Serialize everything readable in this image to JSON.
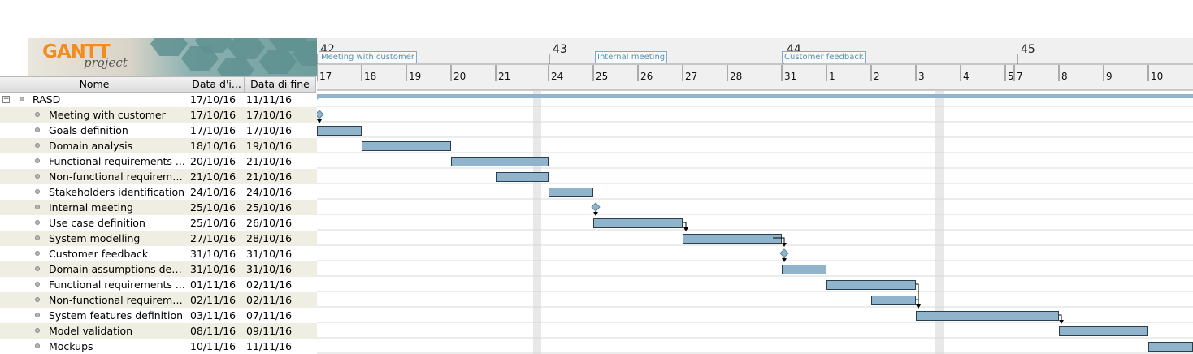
{
  "logo": {
    "brand": "GANTT",
    "product": "project"
  },
  "table": {
    "columns": {
      "name": "Nome",
      "start": "Data d'i...",
      "end": "Data di fine"
    },
    "collapse_symbol": "−",
    "root": {
      "name": "RASD",
      "start": "17/10/16",
      "end": "11/11/16"
    },
    "tasks": [
      {
        "name": "Meeting with customer",
        "start": "17/10/16",
        "end": "17/10/16"
      },
      {
        "name": "Goals definition",
        "start": "17/10/16",
        "end": "17/10/16"
      },
      {
        "name": "Domain analysis",
        "start": "18/10/16",
        "end": "19/10/16"
      },
      {
        "name": "Functional requirements ...",
        "start": "20/10/16",
        "end": "21/10/16"
      },
      {
        "name": "Non-functional requireme...",
        "start": "21/10/16",
        "end": "21/10/16"
      },
      {
        "name": "Stakeholders identification",
        "start": "24/10/16",
        "end": "24/10/16"
      },
      {
        "name": "Internal meeting",
        "start": "25/10/16",
        "end": "25/10/16"
      },
      {
        "name": "Use case definition",
        "start": "25/10/16",
        "end": "26/10/16"
      },
      {
        "name": "System modelling",
        "start": "27/10/16",
        "end": "28/10/16"
      },
      {
        "name": "Customer feedback",
        "start": "31/10/16",
        "end": "31/10/16"
      },
      {
        "name": "Domain assumptions defi...",
        "start": "31/10/16",
        "end": "31/10/16"
      },
      {
        "name": "Functional requirements ...",
        "start": "01/11/16",
        "end": "02/11/16"
      },
      {
        "name": "Non-functional requireme...",
        "start": "02/11/16",
        "end": "02/11/16"
      },
      {
        "name": "System features definition",
        "start": "03/11/16",
        "end": "07/11/16"
      },
      {
        "name": "Model validation",
        "start": "08/11/16",
        "end": "09/11/16"
      },
      {
        "name": "Mockups",
        "start": "10/11/16",
        "end": "11/11/16"
      }
    ]
  },
  "timeline": {
    "weeks": [
      "42",
      "43",
      "44",
      "45"
    ],
    "days": [
      "17",
      "18",
      "19",
      "20",
      "21",
      "24",
      "25",
      "26",
      "27",
      "28",
      "31",
      "1",
      "2",
      "3",
      "4",
      "5",
      "7",
      "8",
      "9",
      "10"
    ],
    "milestone_labels": [
      "Meeting with customer",
      "Internal meeting",
      "Customer feedback"
    ]
  },
  "chart_data": {
    "type": "gantt",
    "series": [
      {
        "task": "RASD",
        "start": "2016-10-17",
        "end": "2016-11-11",
        "kind": "summary"
      },
      {
        "task": "Meeting with customer",
        "start": "2016-10-17",
        "end": "2016-10-17",
        "kind": "milestone"
      },
      {
        "task": "Goals definition",
        "start": "2016-10-17",
        "end": "2016-10-17",
        "kind": "task"
      },
      {
        "task": "Domain analysis",
        "start": "2016-10-18",
        "end": "2016-10-19",
        "kind": "task"
      },
      {
        "task": "Functional requirements ...",
        "start": "2016-10-20",
        "end": "2016-10-21",
        "kind": "task"
      },
      {
        "task": "Non-functional requireme...",
        "start": "2016-10-21",
        "end": "2016-10-21",
        "kind": "task"
      },
      {
        "task": "Stakeholders identification",
        "start": "2016-10-24",
        "end": "2016-10-24",
        "kind": "task"
      },
      {
        "task": "Internal meeting",
        "start": "2016-10-25",
        "end": "2016-10-25",
        "kind": "milestone"
      },
      {
        "task": "Use case definition",
        "start": "2016-10-25",
        "end": "2016-10-26",
        "kind": "task"
      },
      {
        "task": "System modelling",
        "start": "2016-10-27",
        "end": "2016-10-28",
        "kind": "task"
      },
      {
        "task": "Customer feedback",
        "start": "2016-10-31",
        "end": "2016-10-31",
        "kind": "milestone"
      },
      {
        "task": "Domain assumptions defi...",
        "start": "2016-10-31",
        "end": "2016-10-31",
        "kind": "task"
      },
      {
        "task": "Functional requirements ...",
        "start": "2016-11-01",
        "end": "2016-11-02",
        "kind": "task"
      },
      {
        "task": "Non-functional requireme...",
        "start": "2016-11-02",
        "end": "2016-11-02",
        "kind": "task"
      },
      {
        "task": "System features definition",
        "start": "2016-11-03",
        "end": "2016-11-07",
        "kind": "task"
      },
      {
        "task": "Model validation",
        "start": "2016-11-08",
        "end": "2016-11-09",
        "kind": "task"
      },
      {
        "task": "Mockups",
        "start": "2016-11-10",
        "end": "2016-11-11",
        "kind": "task"
      }
    ],
    "dependencies": [
      [
        "Meeting with customer",
        "Goals definition"
      ],
      [
        "Internal meeting",
        "Use case definition"
      ],
      [
        "Use case definition",
        "System modelling"
      ],
      [
        "System modelling",
        "Customer feedback"
      ],
      [
        "Customer feedback",
        "Domain assumptions defi..."
      ],
      [
        "Functional requirements ...",
        "System features definition"
      ],
      [
        "Non-functional requireme...",
        "System features definition"
      ],
      [
        "System features definition",
        "Model validation"
      ]
    ],
    "colors": {
      "bar": "#8fb4cc",
      "bar_border": "#2a3f4e",
      "weekend": "#e8e8e8",
      "summary": "#8fb4cc"
    }
  }
}
